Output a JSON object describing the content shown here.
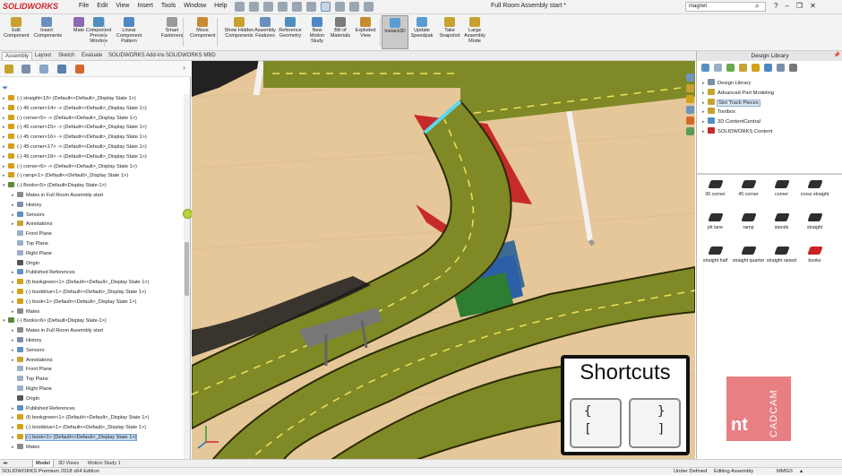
{
  "app": {
    "logo": "SOLIDWORKS",
    "doc_title": "Full Room Assembly start *"
  },
  "menu": [
    "File",
    "Edit",
    "View",
    "Insert",
    "Tools",
    "Window",
    "Help"
  ],
  "search": {
    "value": "magnet"
  },
  "window_buttons": [
    "?",
    "–",
    "❐",
    "✕"
  ],
  "commands": [
    {
      "label": "Edit Component",
      "color": "#c7a230"
    },
    {
      "label": "Insert Components",
      "color": "#6a8fbf"
    },
    {
      "label": "Mate",
      "color": "#8a6bb0"
    },
    {
      "label": "Component Preview Window",
      "color": "#4f8fbf"
    },
    {
      "label": "Linear Component Pattern",
      "color": "#4f88c4"
    },
    {
      "label": "Smart Fasteners",
      "color": "#9a9a9a"
    },
    {
      "label": "Move Component",
      "color": "#c78b30"
    },
    {
      "label": "Show Hidden Components",
      "color": "#c7a230"
    },
    {
      "label": "Assembly Features",
      "color": "#6a8fbf"
    },
    {
      "label": "Reference Geometry",
      "color": "#4f8fbf"
    },
    {
      "label": "New Motion Study",
      "color": "#4f88c4"
    },
    {
      "label": "Bill of Materials",
      "color": "#7a7a7a"
    },
    {
      "label": "Exploded View",
      "color": "#c78b30"
    },
    {
      "label": "Instant3D",
      "color": "#5a9bd4"
    },
    {
      "label": "Update Speedpak",
      "color": "#5a9bd4"
    },
    {
      "label": "Take Snapshot",
      "color": "#c7a230"
    },
    {
      "label": "Large Assembly Mode",
      "color": "#c7a230"
    }
  ],
  "tabs": [
    "Assembly",
    "Layout",
    "Sketch",
    "Evaluate",
    "SOLIDWORKS Add-Ins",
    "SOLIDWORKS MBD"
  ],
  "tree": [
    {
      "text": "(-) straight<13> (Default<<Default>_Display State 1>)",
      "indent": 0,
      "icon": "#d4a017"
    },
    {
      "text": "(-) 45 corner<14> -> (Default<<Default>_Display State 1>)",
      "indent": 0,
      "icon": "#d4a017"
    },
    {
      "text": "(-) corner<5> -> (Default<<Default>_Display State 1>)",
      "indent": 0,
      "icon": "#d4a017"
    },
    {
      "text": "(-) 45 corner<15> -> (Default<<Default>_Display State 1>)",
      "indent": 0,
      "icon": "#d4a017"
    },
    {
      "text": "(-) 45 corner<16> -> (Default<<Default>_Display State 1>)",
      "indent": 0,
      "icon": "#d4a017"
    },
    {
      "text": "(-) 45 corner<17> -> (Default<<Default>_Display State 1>)",
      "indent": 0,
      "icon": "#d4a017"
    },
    {
      "text": "(-) 45 corner<18> -> (Default<<Default>_Display State 1>)",
      "indent": 0,
      "icon": "#d4a017"
    },
    {
      "text": "(-) corner<6> -> (Default<<Default>_Display State 1>)",
      "indent": 0,
      "icon": "#d4a017"
    },
    {
      "text": "(-) ramp<1> (Default<<Default>_Display State 1>)",
      "indent": 0,
      "icon": "#d4a017"
    },
    {
      "text": "(-) Books<5> (Default<Display State-1>)",
      "indent": 0,
      "icon": "#5d8a3a",
      "expanded": true
    },
    {
      "text": "Mates in Full Room Assembly start",
      "indent": 1,
      "icon": "#8a8a8a"
    },
    {
      "text": "History",
      "indent": 1,
      "icon": "#7a8fa8"
    },
    {
      "text": "Sensors",
      "indent": 1,
      "icon": "#5f8fc4"
    },
    {
      "text": "Annotations",
      "indent": 1,
      "icon": "#c7a230"
    },
    {
      "text": "Front Plane",
      "indent": 1,
      "icon": "#9ab0c8",
      "leaf": true
    },
    {
      "text": "Top Plane",
      "indent": 1,
      "icon": "#9ab0c8",
      "leaf": true
    },
    {
      "text": "Right Plane",
      "indent": 1,
      "icon": "#9ab0c8",
      "leaf": true
    },
    {
      "text": "Origin",
      "indent": 1,
      "icon": "#555555",
      "leaf": true
    },
    {
      "text": "Published References",
      "indent": 1,
      "icon": "#5f8fc4"
    },
    {
      "text": "(f) bookgreen<1> (Default<<Default>_Display State 1>)",
      "indent": 1,
      "icon": "#d4a017"
    },
    {
      "text": "(-) bookblue<1> (Default<<Default>_Display State 1>)",
      "indent": 1,
      "icon": "#d4a017"
    },
    {
      "text": "(-) book<1> (Default<<Default>_Display State 1>)",
      "indent": 1,
      "icon": "#d4a017"
    },
    {
      "text": "Mates",
      "indent": 1,
      "icon": "#8a8a8a"
    },
    {
      "text": "(-) Books<6> (Default<Display State-1>)",
      "indent": 0,
      "icon": "#5d8a3a",
      "expanded": true
    },
    {
      "text": "Mates in Full Room Assembly start",
      "indent": 1,
      "icon": "#8a8a8a"
    },
    {
      "text": "History",
      "indent": 1,
      "icon": "#7a8fa8"
    },
    {
      "text": "Sensors",
      "indent": 1,
      "icon": "#5f8fc4"
    },
    {
      "text": "Annotations",
      "indent": 1,
      "icon": "#c7a230"
    },
    {
      "text": "Front Plane",
      "indent": 1,
      "icon": "#9ab0c8",
      "leaf": true
    },
    {
      "text": "Top Plane",
      "indent": 1,
      "icon": "#9ab0c8",
      "leaf": true
    },
    {
      "text": "Right Plane",
      "indent": 1,
      "icon": "#9ab0c8",
      "leaf": true
    },
    {
      "text": "Origin",
      "indent": 1,
      "icon": "#555555",
      "leaf": true
    },
    {
      "text": "Published References",
      "indent": 1,
      "icon": "#5f8fc4"
    },
    {
      "text": "(f) bookgreen<1> (Default<<Default>_Display State 1>)",
      "indent": 1,
      "icon": "#d4a017"
    },
    {
      "text": "(-) bookblue<1> (Default<<Default>_Display State 1>)",
      "indent": 1,
      "icon": "#d4a017"
    },
    {
      "text": "(-) book<1> (Default<<Default>_Display State 1>)",
      "indent": 1,
      "icon": "#d4a017",
      "selected": true
    },
    {
      "text": "Mates",
      "indent": 1,
      "icon": "#8a8a8a"
    }
  ],
  "design_library": {
    "title": "Design Library",
    "items": [
      {
        "text": "Design Library",
        "icon": "#7a8fa8",
        "selected": false
      },
      {
        "text": "Advanced Part Modeling",
        "icon": "#c7a230",
        "selected": false
      },
      {
        "text": "Slot Track Pieces",
        "icon": "#c7a230",
        "selected": true
      },
      {
        "text": "Toolbox",
        "icon": "#c7a230",
        "selected": false
      },
      {
        "text": "3D ContentCentral",
        "icon": "#4f8fbf",
        "selected": false
      },
      {
        "text": "SOLIDWORKS Content",
        "icon": "#c42b2b",
        "selected": false
      }
    ],
    "pieces": [
      {
        "label": "30 corner",
        "red": false
      },
      {
        "label": "45 corner",
        "red": false
      },
      {
        "label": "corner",
        "red": false
      },
      {
        "label": "cross straight",
        "red": false
      },
      {
        "label": "pit lane",
        "red": false
      },
      {
        "label": "ramp",
        "red": false
      },
      {
        "label": "stands",
        "red": false
      },
      {
        "label": "straight",
        "red": false
      },
      {
        "label": "straight half",
        "red": false
      },
      {
        "label": "straight quarter",
        "red": false
      },
      {
        "label": "straight raised",
        "red": false
      },
      {
        "label": "books",
        "red": true
      }
    ]
  },
  "overlay": {
    "title": "Shortcuts",
    "key_left": [
      "{",
      "["
    ],
    "key_right": [
      "}",
      "]"
    ]
  },
  "brand": {
    "text": "nt",
    "sub": "CADCAM"
  },
  "bottom_tabs": [
    "Model",
    "3D Views",
    "Motion Study 1"
  ],
  "status": {
    "left": "SOLIDWORKS Premium 2018 x64 Edition",
    "mid1": "Under Defined",
    "mid2": "Editing Assembly",
    "units": "MMGS",
    "arrow": "▴"
  },
  "colors": {
    "track": "#7f8a26",
    "wood": "#e8c99c",
    "book_red": "#c62a2a",
    "book_green": "#2e7d32",
    "book_blue": "#2c5fa8"
  }
}
